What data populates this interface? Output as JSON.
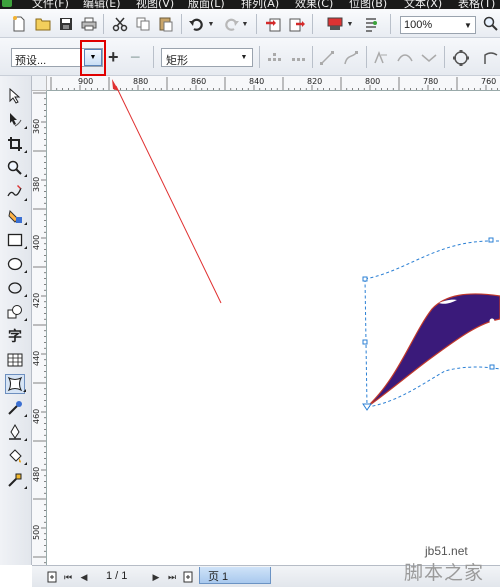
{
  "menubar": {
    "items": [
      "文件(F)",
      "编辑(E)",
      "视图(V)",
      "版面(L)",
      "排列(A)",
      "效果(C)",
      "位图(B)",
      "文本(X)",
      "表格(T)"
    ]
  },
  "std_toolbar": {
    "zoom_value": "100%",
    "icons": [
      "new-icon",
      "open-icon",
      "save-icon",
      "print-icon",
      "cut-icon",
      "copy-icon",
      "paste-icon",
      "undo-icon",
      "redo-icon",
      "import-icon",
      "export-icon",
      "app-launcher-icon",
      "welcome-screen-icon",
      "zoom-icon"
    ]
  },
  "property_bar": {
    "preset_value": "预设...",
    "shape_value": "矩形"
  },
  "rulers": {
    "horizontal_ticks": [
      "900",
      "880",
      "860",
      "840",
      "820",
      "800",
      "780",
      "760"
    ],
    "vertical_ticks": [
      "360",
      "380",
      "400",
      "420",
      "440",
      "460",
      "480",
      "500"
    ]
  },
  "page_nav": {
    "page_count": "1 / 1",
    "page_tab": "页 1"
  },
  "watermark": {
    "site": "jb51.net",
    "brand": "脚本之家"
  },
  "colors": {
    "shape_fill": "#3a1a7a",
    "shape_edge": "#c0392b",
    "envelope_line": "#2a7fd4",
    "highlight_box": "#e00000",
    "annotation_arrow": "#e03030",
    "menubar_bg": "#1a1a1a"
  }
}
